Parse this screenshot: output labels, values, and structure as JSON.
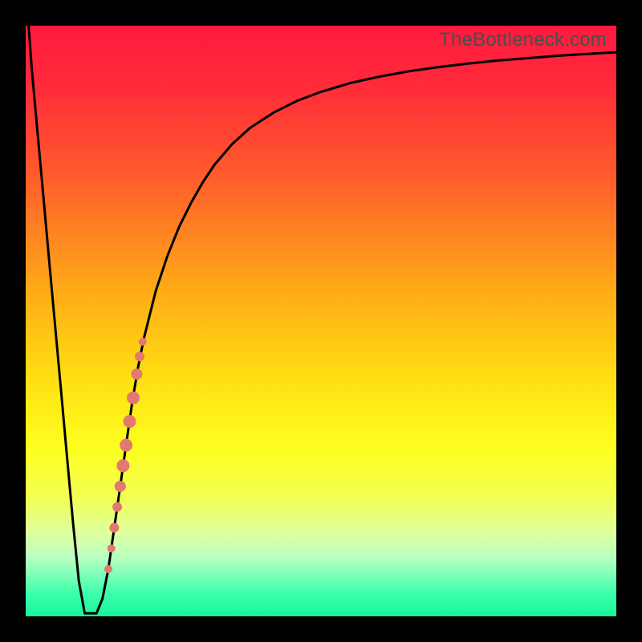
{
  "watermark": {
    "text": "TheBottleneck.com"
  },
  "chart_data": {
    "type": "line",
    "title": "",
    "xlabel": "",
    "ylabel": "",
    "xlim": [
      0,
      100
    ],
    "ylim": [
      0,
      100
    ],
    "gradient_stops": [
      {
        "offset": 0.0,
        "color": "#ff1a3f"
      },
      {
        "offset": 0.1,
        "color": "#ff2a3a"
      },
      {
        "offset": 0.25,
        "color": "#ff5a2c"
      },
      {
        "offset": 0.45,
        "color": "#ffab17"
      },
      {
        "offset": 0.6,
        "color": "#ffe012"
      },
      {
        "offset": 0.72,
        "color": "#fdff20"
      },
      {
        "offset": 0.8,
        "color": "#f2ff55"
      },
      {
        "offset": 0.86,
        "color": "#deffa0"
      },
      {
        "offset": 0.9,
        "color": "#b9ffc0"
      },
      {
        "offset": 0.93,
        "color": "#7effb8"
      },
      {
        "offset": 0.96,
        "color": "#3effac"
      },
      {
        "offset": 1.0,
        "color": "#17f59c"
      }
    ],
    "series": [
      {
        "name": "bottleneck-curve",
        "x": [
          0.5,
          1,
          2,
          3,
          4,
          5,
          6,
          7,
          8,
          9,
          10,
          11,
          12,
          13,
          14,
          15,
          16,
          17,
          18,
          19,
          20,
          22,
          24,
          26,
          28,
          30,
          32,
          35,
          38,
          42,
          46,
          50,
          55,
          60,
          65,
          70,
          75,
          80,
          85,
          90,
          95,
          100
        ],
        "y": [
          100,
          93,
          82,
          71,
          60,
          49,
          38,
          27,
          16,
          6,
          0.5,
          0.5,
          0.5,
          3,
          8,
          15,
          22,
          29,
          36,
          42,
          47,
          55,
          61,
          66,
          70,
          73.5,
          76.5,
          80,
          82.7,
          85.3,
          87.3,
          88.8,
          90.3,
          91.4,
          92.3,
          93,
          93.6,
          94.1,
          94.5,
          94.9,
          95.2,
          95.5
        ]
      }
    ],
    "highlight_points": {
      "name": "bottleneck-markers",
      "color": "#e2796f",
      "points": [
        {
          "x": 14.0,
          "y": 8.0,
          "r": 5
        },
        {
          "x": 14.5,
          "y": 11.5,
          "r": 5
        },
        {
          "x": 15.0,
          "y": 15.0,
          "r": 6
        },
        {
          "x": 15.5,
          "y": 18.5,
          "r": 6
        },
        {
          "x": 16.0,
          "y": 22.0,
          "r": 7
        },
        {
          "x": 16.5,
          "y": 25.5,
          "r": 8
        },
        {
          "x": 17.0,
          "y": 29.0,
          "r": 8
        },
        {
          "x": 17.6,
          "y": 33.0,
          "r": 8
        },
        {
          "x": 18.2,
          "y": 37.0,
          "r": 8
        },
        {
          "x": 18.8,
          "y": 41.0,
          "r": 7
        },
        {
          "x": 19.3,
          "y": 44.0,
          "r": 6
        },
        {
          "x": 19.8,
          "y": 46.5,
          "r": 5
        }
      ]
    }
  }
}
